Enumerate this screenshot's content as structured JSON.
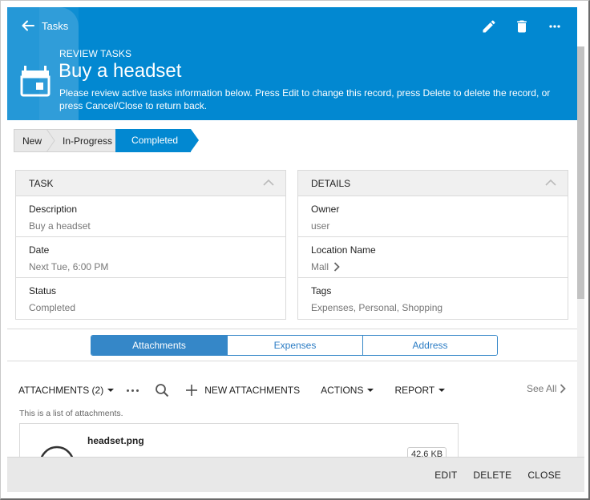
{
  "header": {
    "back_label": "Tasks",
    "subtitle": "REVIEW TASKS",
    "title": "Buy a headset",
    "description": "Please review active tasks information below. Press Edit to change this record, press Delete to delete the record, or press Cancel/Close to return back.",
    "actions": [
      {
        "name": "edit",
        "icon": "pencil-icon"
      },
      {
        "name": "delete",
        "icon": "trash-icon"
      },
      {
        "name": "more",
        "icon": "more-horizontal-icon"
      }
    ],
    "icon": "calendar-icon",
    "color": "#0288d1"
  },
  "status_flow": {
    "steps": [
      "New",
      "In-Progress",
      "Completed"
    ],
    "active": "Completed",
    "active_color": "#0288d1"
  },
  "panels": {
    "task": {
      "title": "TASK",
      "fields": [
        {
          "label": "Description",
          "value": "Buy a headset"
        },
        {
          "label": "Date",
          "value": "Next Tue, 6:00 PM"
        },
        {
          "label": "Status",
          "value": "Completed"
        }
      ]
    },
    "details": {
      "title": "DETAILS",
      "fields": [
        {
          "label": "Owner",
          "value": "user"
        },
        {
          "label": "Location Name",
          "value": "Mall"
        },
        {
          "label": "Tags",
          "value": "Expenses, Personal, Shopping"
        }
      ]
    }
  },
  "tabs": [
    {
      "label": "Attachments",
      "active": true
    },
    {
      "label": "Expenses",
      "active": false
    },
    {
      "label": "Address",
      "active": false
    }
  ],
  "attachments": {
    "toolbar": {
      "view_label": "ATTACHMENTS (2)",
      "new_label": "NEW ATTACHMENTS",
      "actions_label": "ACTIONS",
      "report_label": "REPORT",
      "see_all_label": "See All"
    },
    "description": "This is a list of attachments.",
    "items": [
      {
        "file_name": "headset.png",
        "size": "42.6 KB"
      }
    ]
  },
  "footer": {
    "buttons": [
      "EDIT",
      "DELETE",
      "CLOSE"
    ]
  }
}
